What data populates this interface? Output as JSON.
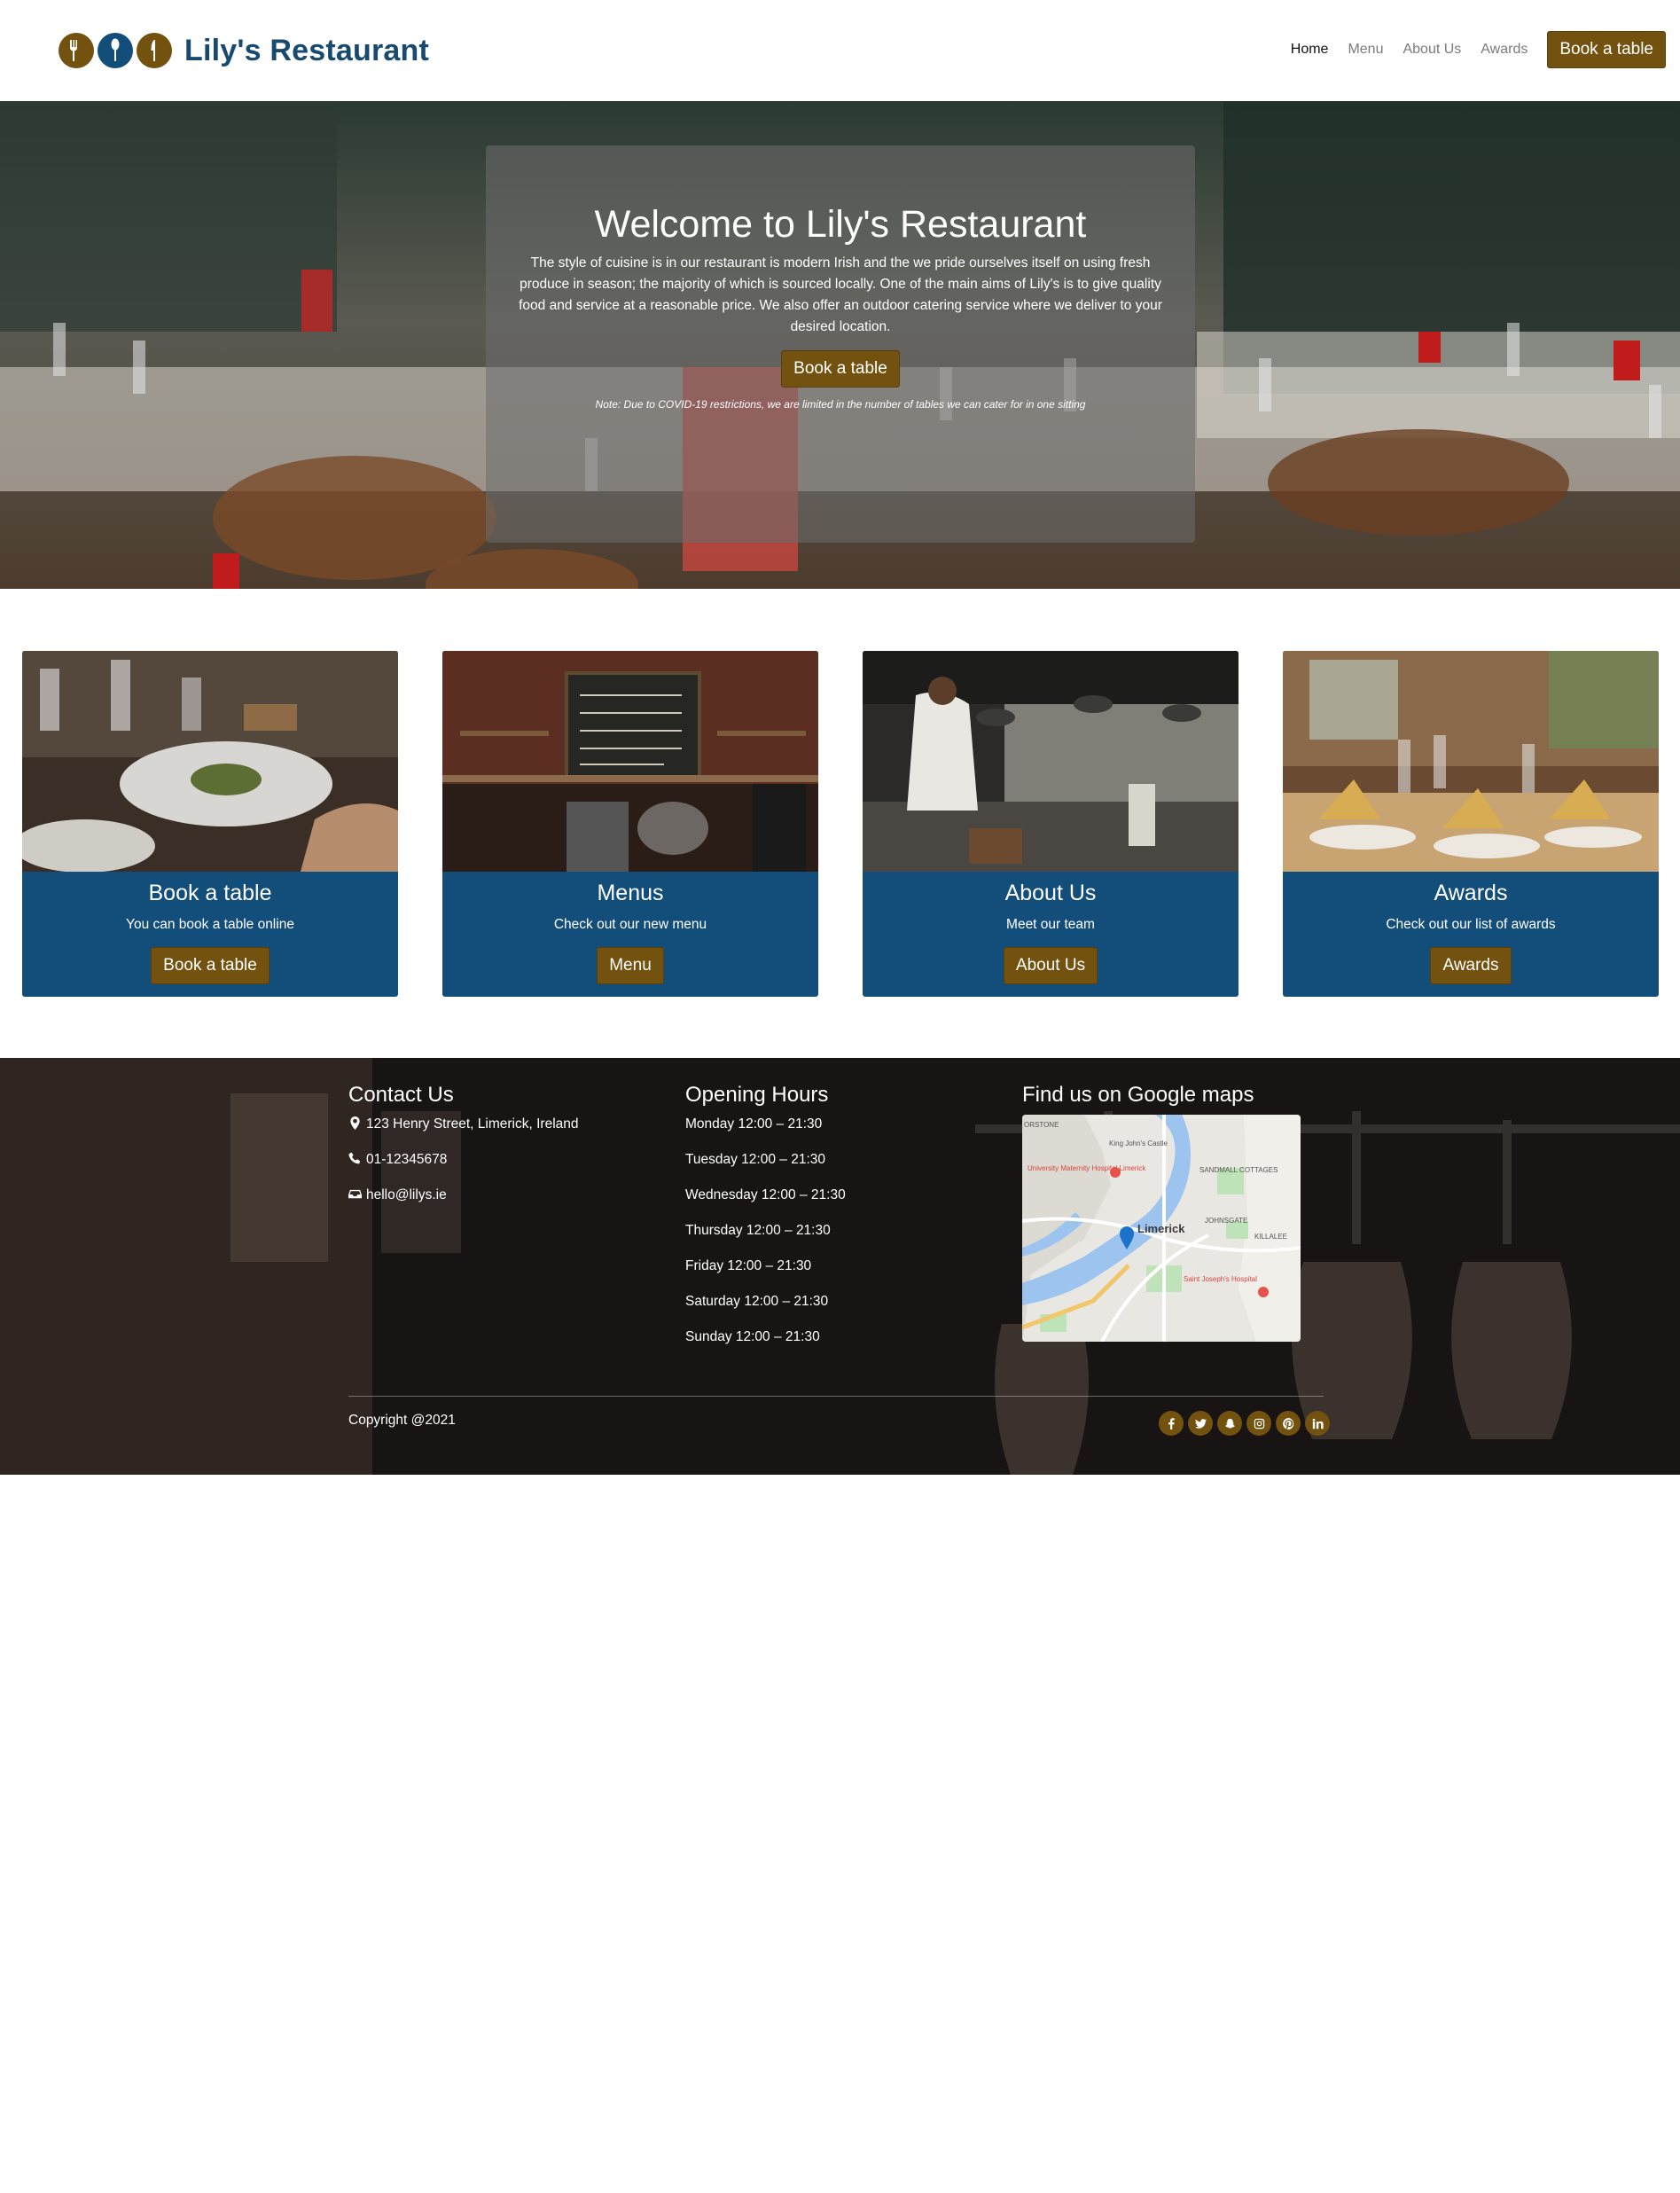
{
  "brand": {
    "name": "Lily's Restaurant",
    "logo_colors": [
      "#72520e",
      "#124e79",
      "#72520e"
    ]
  },
  "nav": {
    "links": [
      "Home",
      "Menu",
      "About Us",
      "Awards"
    ],
    "active": "Home",
    "cta_label": "Book a table"
  },
  "hero": {
    "title": "Welcome to Lily's Restaurant",
    "text": "The style of cuisine is in our restaurant is modern Irish and the we pride ourselves itself on using fresh produce in season; the majority of which is sourced locally. One of the main aims of Lily's is to give quality food and service at a reasonable price. We also offer an outdoor catering service where we deliver to your desired location.",
    "button_label": "Book a table",
    "note": "Note: Due to COVID-19 restrictions, we are limited in the number of tables we can cater for in one sitting"
  },
  "cards": [
    {
      "title": "Book a table",
      "subtitle": "You can book a table online",
      "button": "Book a table"
    },
    {
      "title": "Menus",
      "subtitle": "Check out our new menu",
      "button": "Menu"
    },
    {
      "title": "About Us",
      "subtitle": "Meet our team",
      "button": "About Us"
    },
    {
      "title": "Awards",
      "subtitle": "Check out our list of awards",
      "button": "Awards"
    }
  ],
  "footer": {
    "contact": {
      "heading": "Contact Us",
      "address": "123 Henry Street, Limerick, Ireland",
      "phone": "01-12345678",
      "email": "hello@lilys.ie"
    },
    "hours": {
      "heading": "Opening Hours",
      "days": [
        "Monday 12:00 – 21:30",
        "Tuesday 12:00 – 21:30",
        "Wednesday 12:00 – 21:30",
        "Thursday 12:00 – 21:30",
        "Friday 12:00 – 21:30",
        "Saturday 12:00 – 21:30",
        "Sunday 12:00 – 21:30"
      ]
    },
    "maps": {
      "heading": "Find us on Google maps",
      "labels": {
        "limerick": "Limerick",
        "hospital": "University Maternity Hospital Limerick",
        "castle": "King John's Castle",
        "sandmall": "SANDMALL COTTAGES",
        "johnsgate": "JOHNSGATE",
        "killalee": "KILLALEE",
        "stjoseph": "Saint Joseph's Hospital",
        "thorstone": "ORSTONE"
      }
    },
    "copyright": "Copyright @2021",
    "socials": [
      "facebook-icon",
      "twitter-icon",
      "snapchat-icon",
      "instagram-icon",
      "pinterest-icon",
      "linkedin-icon"
    ]
  },
  "colors": {
    "brand_blue": "#184a70",
    "card_blue": "#124e79",
    "accent_gold": "#72520e"
  }
}
